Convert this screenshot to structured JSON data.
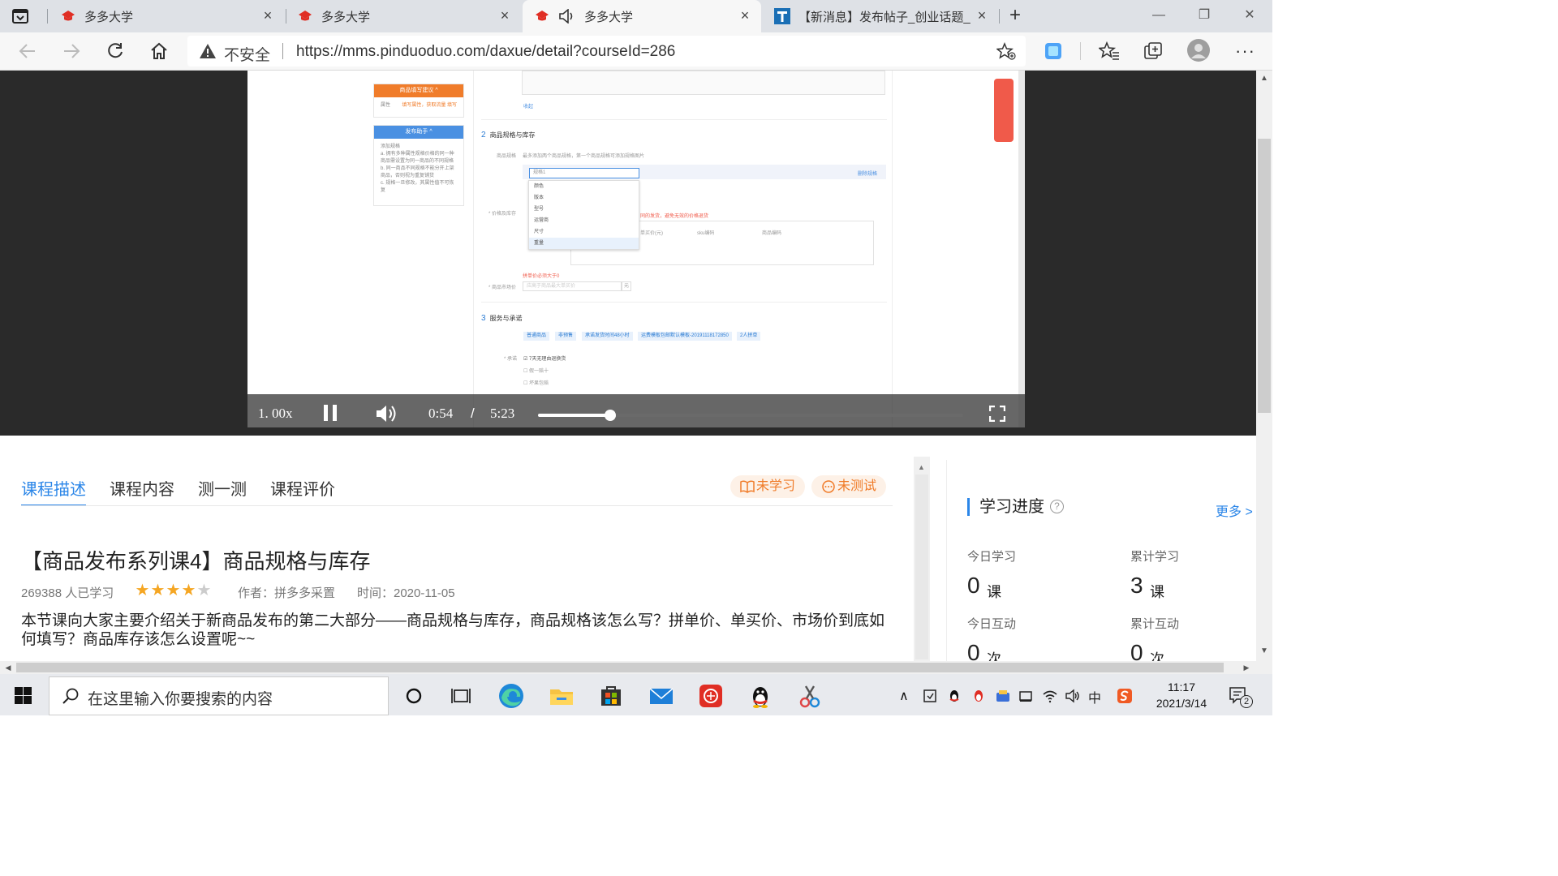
{
  "browser": {
    "tabs": [
      {
        "title": "多多大学",
        "active": false
      },
      {
        "title": "多多大学",
        "active": false
      },
      {
        "title": "多多大学",
        "active": true,
        "audio": true
      },
      {
        "title": "【新消息】发布帖子_创业话题_",
        "active": false
      }
    ],
    "security_label": "不安全",
    "url": "https://mms.pinduoduo.com/daxue/detail?courseId=286"
  },
  "video": {
    "speed": "1. 00x",
    "current_time": "0:54",
    "separator": "/",
    "duration": "5:23",
    "progress": 0.17,
    "frame": {
      "side_card_1_title": "商品填写建议 ^",
      "side_card_1_items": [
        "属性",
        "填写属性，获取流量 填写"
      ],
      "side_card_2_title": "发布助手 ^",
      "side_card_2_text": [
        "添加规格",
        "a. 拥有多种属性规格价格的同一种商品需设置为同一商品的不同规格",
        "b. 同一商品不同规格不能分开上架商品，否则视为重复铺货",
        "c. 规格一旦修改，其属性值不可恢复"
      ],
      "collapse_label": "收起",
      "section2_num": "2",
      "section2_title": "商品规格与库存",
      "spec_label": "商品规格",
      "spec_hint": "最多添加两个商品规格，第一个商品规格可添加规格图片",
      "spec_placeholder": "规格1",
      "delete_spec": "删除规格",
      "dropdown_options": [
        "颜色",
        "版本",
        "型号",
        "运营商",
        "尺寸",
        "重量"
      ],
      "price_stock_label": "* 价格及库存",
      "warning_text": "同的发货，避免无效的价格退货",
      "table_headers": [
        "单买价(元)",
        "sku编码",
        "商品编码"
      ],
      "min_price_error": "拼单价必须大于0",
      "market_price_label": "* 商品市场价",
      "market_price_placeholder": "应高于商品最大单买价",
      "currency": "元",
      "section3_num": "3",
      "section3_title": "服务与承诺",
      "service_tags": [
        "普通商品",
        "非预售",
        "承诺发货时间48小时",
        "运费模板包邮默认模板-20191118172850",
        "2人拼单"
      ],
      "promise_label": "* 承诺",
      "promises": [
        "7天无理由退换货",
        "假一赔十",
        "坏果包赔"
      ]
    }
  },
  "course_tabs": [
    "课程描述",
    "课程内容",
    "测一测",
    "课程评价"
  ],
  "status_pills": {
    "study": "未学习",
    "test": "未测试"
  },
  "course": {
    "title": "【商品发布系列课4】商品规格与库存",
    "learners": "269388 人已学习",
    "rating": 4,
    "rating_max": 5,
    "author": "作者：拼多多采置",
    "time": "时间：2020-11-05",
    "description": "本节课向大家主要介绍关于新商品发布的第二大部分——商品规格与库存，商品规格该怎么写？拼单价、单买价、市场价到底如何填写？商品库存该怎么设置呢~~"
  },
  "progress_panel": {
    "title": "学习进度",
    "help": "?",
    "more": "更多 >",
    "today_study_label": "今日学习",
    "today_study_value": "0",
    "today_study_unit": "课",
    "total_study_label": "累计学习",
    "total_study_value": "3",
    "total_study_unit": "课",
    "today_interact_label": "今日互动",
    "today_interact_value": "0",
    "today_interact_unit": "次",
    "total_interact_label": "累计互动",
    "total_interact_value": "0",
    "total_interact_unit": "次"
  },
  "taskbar": {
    "search_placeholder": "在这里输入你要搜索的内容",
    "time": "11:17",
    "date": "2021/3/14",
    "ime": "中",
    "notifications": "2"
  },
  "colors": {
    "accent": "#2b86e8",
    "orange": "#f07c2a",
    "star": "#f5a623",
    "pdd_red": "#e02e24"
  }
}
